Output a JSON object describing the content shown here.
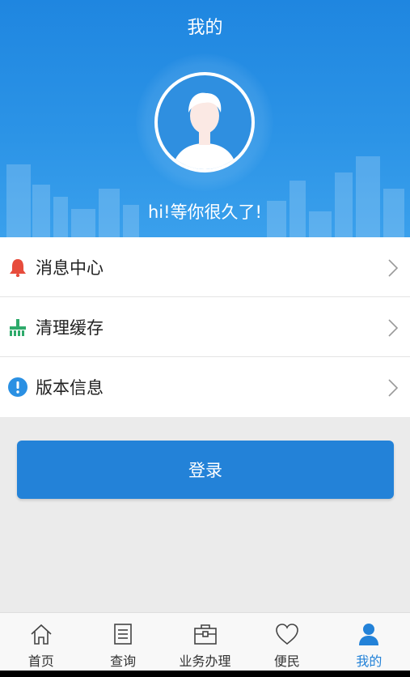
{
  "header": {
    "title": "我的",
    "greeting": "hi!等你很久了!"
  },
  "menu": {
    "items": [
      {
        "label": "消息中心",
        "icon": "bell-icon",
        "color": "#e74c3c"
      },
      {
        "label": "清理缓存",
        "icon": "broom-icon",
        "color": "#2eaa6b"
      },
      {
        "label": "版本信息",
        "icon": "info-icon",
        "color": "#2a90e3"
      }
    ]
  },
  "login": {
    "label": "登录"
  },
  "tabbar": {
    "accent": "#2382d8",
    "items": [
      {
        "label": "首页",
        "icon": "home-icon",
        "active": false
      },
      {
        "label": "查询",
        "icon": "document-icon",
        "active": false
      },
      {
        "label": "业务办理",
        "icon": "briefcase-icon",
        "active": false
      },
      {
        "label": "便民",
        "icon": "heart-icon",
        "active": false
      },
      {
        "label": "我的",
        "icon": "person-icon",
        "active": true
      }
    ]
  }
}
